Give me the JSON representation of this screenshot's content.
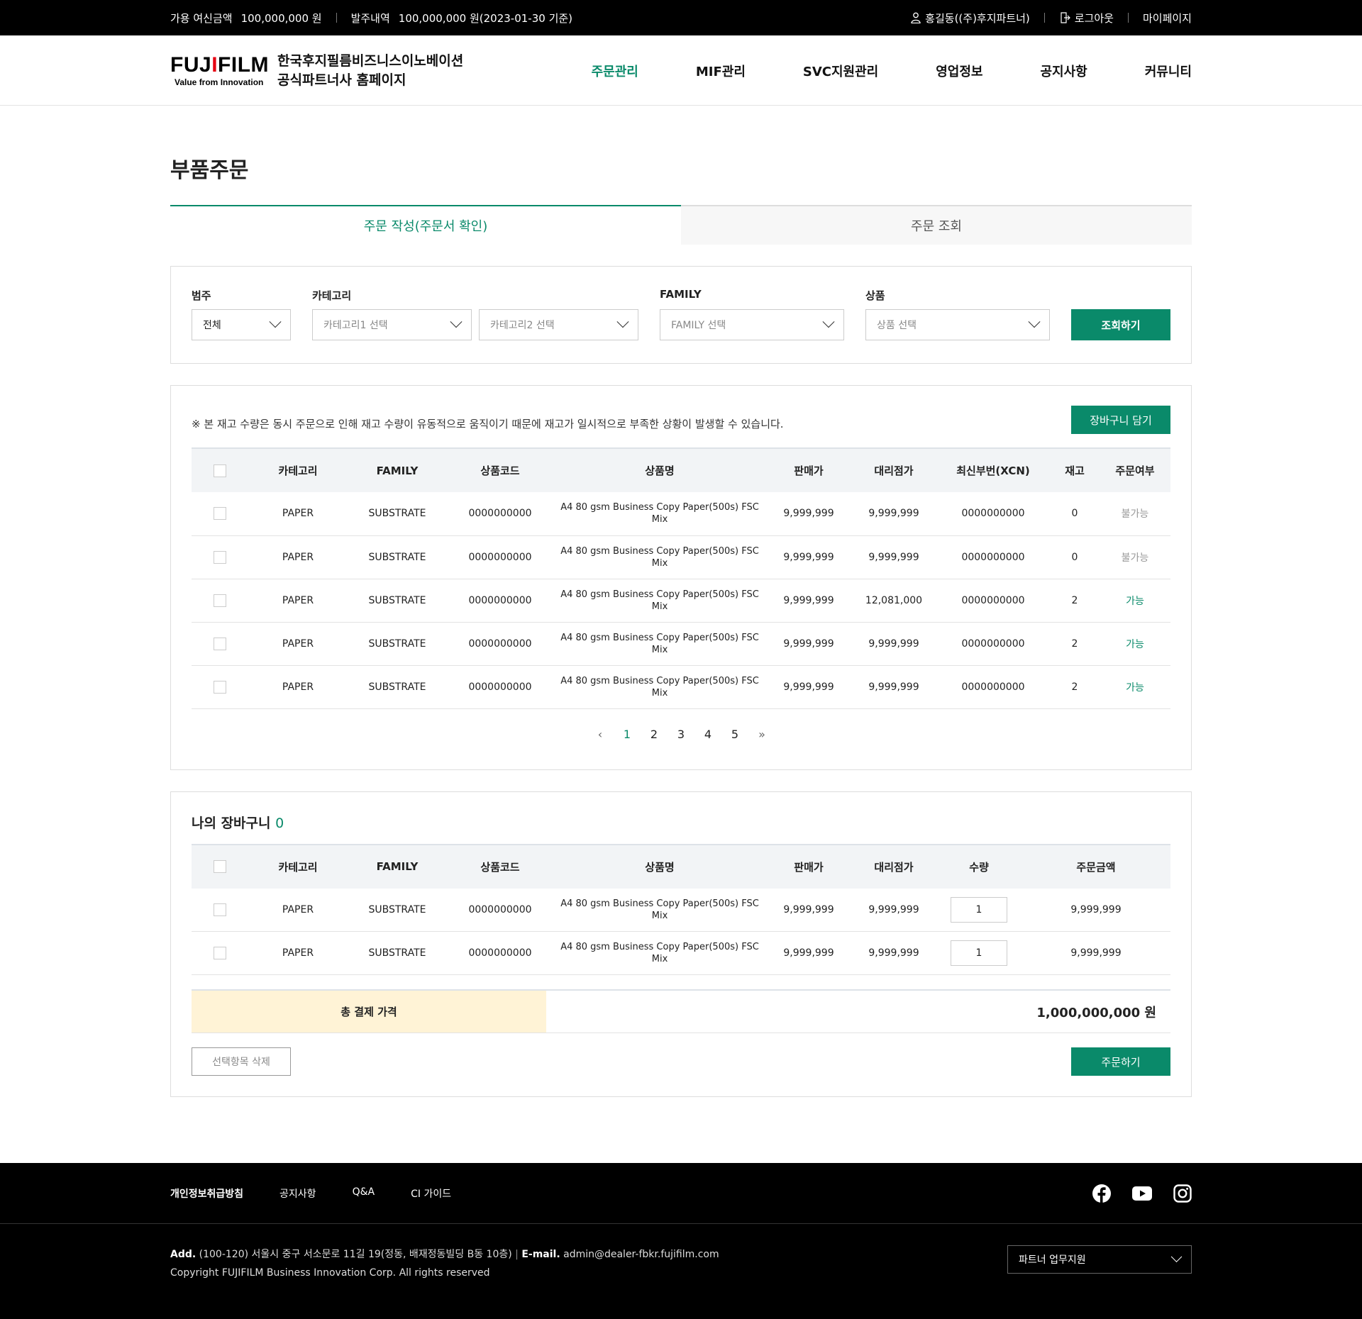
{
  "topbar": {
    "credit_label": "가용 여신금액",
    "credit_value": "100,000,000 원",
    "order_label": "발주내역",
    "order_value": "100,000,000 원(2023-01-30 기준)",
    "user": "홍길동((주)후지파트너)",
    "logout": "로그아웃",
    "mypage": "마이페이지"
  },
  "header": {
    "logo_main_a": "FUJ",
    "logo_main_i": "I",
    "logo_main_b": "FILM",
    "logo_sub": "Value from Innovation",
    "brand_line1": "한국후지필름비즈니스이노베이션",
    "brand_line2": "공식파트너사 홈페이지",
    "nav": [
      "주문관리",
      "MIF관리",
      "SVC지원관리",
      "영업정보",
      "공지사항",
      "커뮤니티"
    ]
  },
  "page_title": "부품주문",
  "tabs": [
    "주문 작성(주문서 확인)",
    "주문 조회"
  ],
  "filter": {
    "label_scope": "범주",
    "label_category": "카테고리",
    "label_family": "FAMILY",
    "label_product": "상품",
    "scope_value": "전체",
    "category1": "카테고리1 선택",
    "category2": "카테고리2 선택",
    "family": "FAMILY 선택",
    "product": "상품 선택",
    "search_button": "조회하기"
  },
  "stock": {
    "notice": "※ 본 재고 수량은 동시 주문으로 인해 재고 수량이 유동적으로 움직이기 때문에 재고가 일시적으로 부족한 상황이 발생할 수 있습니다.",
    "add_cart_button": "장바구니 담기",
    "headers": [
      "카테고리",
      "FAMILY",
      "상품코드",
      "상품명",
      "판매가",
      "대리점가",
      "최신부번(XCN)",
      "재고",
      "주문여부"
    ],
    "rows": [
      {
        "category": "PAPER",
        "family": "SUBSTRATE",
        "code": "0000000000",
        "name_1": "A4 80 gsm Business Copy Paper(500s) FSC",
        "name_2": "Mix",
        "price": "9,999,999",
        "dealer": "9,999,999",
        "xcn": "0000000000",
        "stock": "0",
        "status": "불가능"
      },
      {
        "category": "PAPER",
        "family": "SUBSTRATE",
        "code": "0000000000",
        "name_1": "A4 80 gsm Business Copy Paper(500s) FSC",
        "name_2": "Mix",
        "price": "9,999,999",
        "dealer": "9,999,999",
        "xcn": "0000000000",
        "stock": "0",
        "status": "불가능"
      },
      {
        "category": "PAPER",
        "family": "SUBSTRATE",
        "code": "0000000000",
        "name_1": "A4 80 gsm Business Copy Paper(500s) FSC",
        "name_2": "Mix",
        "price": "9,999,999",
        "dealer": "12,081,000",
        "xcn": "0000000000",
        "stock": "2",
        "status": "가능"
      },
      {
        "category": "PAPER",
        "family": "SUBSTRATE",
        "code": "0000000000",
        "name_1": "A4 80 gsm Business Copy Paper(500s) FSC",
        "name_2": "Mix",
        "price": "9,999,999",
        "dealer": "9,999,999",
        "xcn": "0000000000",
        "stock": "2",
        "status": "가능"
      },
      {
        "category": "PAPER",
        "family": "SUBSTRATE",
        "code": "0000000000",
        "name_1": "A4 80 gsm Business Copy Paper(500s) FSC",
        "name_2": "Mix",
        "price": "9,999,999",
        "dealer": "9,999,999",
        "xcn": "0000000000",
        "stock": "2",
        "status": "가능"
      }
    ],
    "pages": [
      "1",
      "2",
      "3",
      "4",
      "5"
    ],
    "prev": "‹",
    "last": "»"
  },
  "cart": {
    "title": "나의 장바구니",
    "count": "0",
    "headers": [
      "카테고리",
      "FAMILY",
      "상품코드",
      "상품명",
      "판매가",
      "대리점가",
      "수량",
      "주문금액"
    ],
    "rows": [
      {
        "category": "PAPER",
        "family": "SUBSTRATE",
        "code": "0000000000",
        "name_1": "A4 80 gsm Business Copy Paper(500s) FSC",
        "name_2": "Mix",
        "price": "9,999,999",
        "dealer": "9,999,999",
        "qty": "1",
        "amount": "9,999,999"
      },
      {
        "category": "PAPER",
        "family": "SUBSTRATE",
        "code": "0000000000",
        "name_1": "A4 80 gsm Business Copy Paper(500s) FSC",
        "name_2": "Mix",
        "price": "9,999,999",
        "dealer": "9,999,999",
        "qty": "1",
        "amount": "9,999,999"
      }
    ],
    "total_label": "총 결제 가격",
    "total_value": "1,000,000,000 원",
    "delete_button": "선택항목 삭제",
    "order_button": "주문하기"
  },
  "footer": {
    "links": [
      "개인정보취급방침",
      "공지사항",
      "Q&A",
      "CI 가이드"
    ],
    "social_icons": [
      "facebook-icon",
      "youtube-icon",
      "instagram-icon"
    ],
    "addr_label": "Add.",
    "addr_value": "(100-120) 서울시 중구 서소문로 11길 19(정동, 배재정동빌딩 B동 10층)",
    "email_label": "E-mail.",
    "email_value": "admin@dealer-fbkr.fujifilm.com",
    "copyright": "Copyright FUJIFILM Business Innovation Corp. All rights reserved",
    "support_select": "파트너 업무지원"
  },
  "colors": {
    "accent": "#0a8a6a",
    "total_bg": "#fff3d6",
    "topbar_bg": "#000000"
  }
}
